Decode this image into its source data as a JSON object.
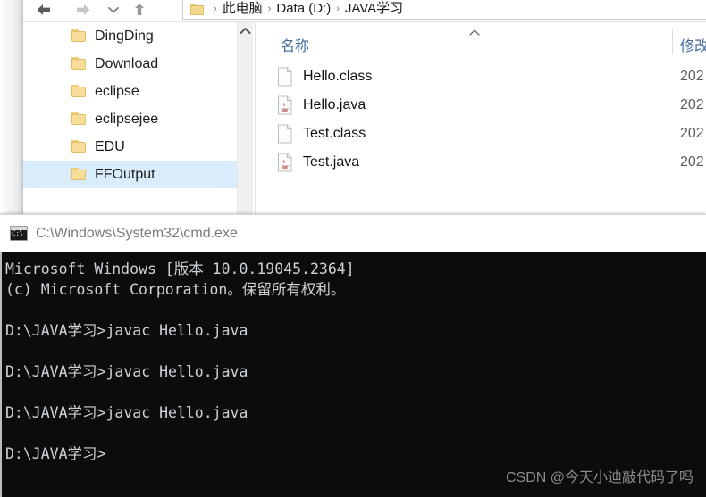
{
  "explorer": {
    "nav": {
      "back_label": "Back",
      "forward_label": "Forward",
      "recent_label": "Recent locations",
      "up_label": "Up"
    },
    "breadcrumb": {
      "folder_icon": "folder-icon",
      "segments": [
        "此电脑",
        "Data (D:)",
        "JAVA学习"
      ],
      "separator": "›"
    },
    "tree": {
      "items": [
        {
          "label": "DingDing",
          "selected": false
        },
        {
          "label": "Download",
          "selected": false
        },
        {
          "label": "eclipse",
          "selected": false
        },
        {
          "label": "eclipsejee",
          "selected": false
        },
        {
          "label": "EDU",
          "selected": false
        },
        {
          "label": "FFOutput",
          "selected": true
        }
      ],
      "scroll_up_icon": "chevron-up-icon"
    },
    "list": {
      "columns": {
        "name": "名称",
        "modified": "修改"
      },
      "sort_caret_icon": "caret-up-icon",
      "rows": [
        {
          "name": "Hello.class",
          "icon": "generic-file-icon",
          "date": "202"
        },
        {
          "name": "Hello.java",
          "icon": "java-file-icon",
          "date": "202"
        },
        {
          "name": "Test.class",
          "icon": "generic-file-icon",
          "date": "202"
        },
        {
          "name": "Test.java",
          "icon": "java-file-icon",
          "date": "202"
        }
      ]
    }
  },
  "console": {
    "icon": "cmd-icon",
    "icon_text": "C:\\",
    "title": "C:\\Windows\\System32\\cmd.exe",
    "lines": [
      "Microsoft Windows [版本 10.0.19045.2364]",
      "(c) Microsoft Corporation。保留所有权利。",
      "",
      "D:\\JAVA学习>javac Hello.java",
      "",
      "D:\\JAVA学习>javac Hello.java",
      "",
      "D:\\JAVA学习>javac Hello.java",
      "",
      "D:\\JAVA学习>"
    ],
    "watermark": "CSDN @今天小迪敲代码了吗"
  },
  "colors": {
    "console_bg": "#0c0c0c",
    "console_fg": "#ccd2d8",
    "selection_blue": "#d8ecfb",
    "header_blue": "#41699b",
    "folder_yellow": "#f7dd97"
  }
}
